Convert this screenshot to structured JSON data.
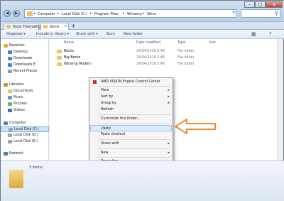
{
  "window": {
    "nav_back": "◀",
    "nav_forward": "▶",
    "breadcrumbs": [
      "Computer",
      "Local Disk (C:)",
      "Program Files",
      "Winamp",
      "Skins"
    ],
    "crumb_separator": "▸",
    "refresh_icon": "↻",
    "search_icon": "⚲",
    "min": "–",
    "max": "□",
    "close": "x"
  },
  "tabs": [
    {
      "label": "Tools Themeing",
      "close": "x"
    },
    {
      "label": "Skins",
      "close": "x"
    }
  ],
  "tab_add": "+",
  "toolbar": {
    "organize": "Organize ▾",
    "include": "Include in library ▾",
    "share": "Share with ▾",
    "burn": "Burn",
    "new_folder": "New folder",
    "view_icon": "▦",
    "help_icon": "?"
  },
  "nav": {
    "favorites": "Favorites",
    "desktop": "Desktop",
    "downloads": "Downloads",
    "downloads_e": "Downloads E",
    "recent": "Recent Places",
    "libraries": "Libraries",
    "documents": "Documents",
    "music": "Music",
    "pictures": "Pictures",
    "videos": "Videos",
    "computer": "Computer",
    "disk_c": "Local Disk (C:)",
    "disk_d": "Local Disk (D:)",
    "disk_e": "Local Disk (E:)",
    "network": "Network"
  },
  "columns": {
    "name": "Name",
    "date": "Date modified",
    "type": "Type",
    "size": "Size"
  },
  "files": [
    {
      "name": "Bento",
      "date": "24/04/2016 5:48",
      "type": "File folder"
    },
    {
      "name": "Big Bento",
      "date": "24/04/2016 5:48",
      "type": "File folder"
    },
    {
      "name": "Winamp Modern",
      "date": "24/04/2016 5:48",
      "type": "File folder"
    }
  ],
  "context_menu": {
    "amd": "AMD VISION Engine Control Center",
    "view": "View",
    "sort_by": "Sort by",
    "group_by": "Group by",
    "refresh": "Refresh",
    "customize": "Customize this folder...",
    "paste": "Paste",
    "paste_shortcut": "Paste shortcut",
    "share_with": "Share with",
    "new": "New",
    "properties": "Properties",
    "submenu_arrow": "▸"
  },
  "status": {
    "items": "3 items"
  },
  "colors": {
    "arrow": "#f08a2c",
    "accent": "#2a62b8"
  }
}
